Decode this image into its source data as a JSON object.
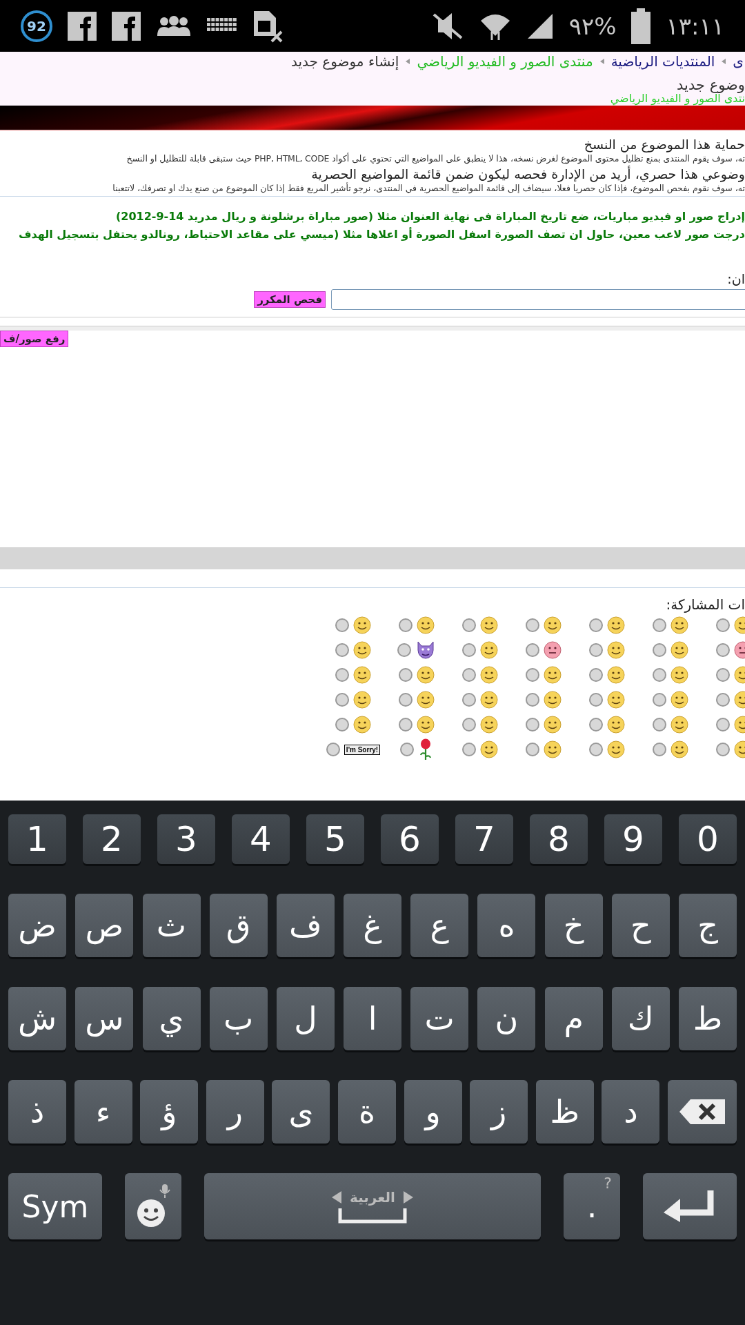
{
  "status_bar": {
    "badge": "92",
    "battery": "٩٢%",
    "time": "١٣:١١"
  },
  "breadcrumb": [
    {
      "text": "ى",
      "kind": "link"
    },
    {
      "text": "المنتديات الرياضية",
      "kind": "link"
    },
    {
      "text": "منتدى الصور و الفيديو الرياضي",
      "kind": "forum"
    },
    {
      "text": "إنشاء موضوع جديد",
      "kind": "current"
    }
  ],
  "page_title": "وضوع جديد",
  "forum_name": "نتدى الصور و الفيديو الرياضي",
  "options": [
    {
      "title": "حماية هذا الموضوع من النسخ",
      "description": "ته، سوف يقوم المنتدى بمنع تظليل محتوى الموضوع لغرض نسخه، هذا لا ينطبق على المواضيع التي تحتوي على أكواد PHP, HTML, CODE حيث ستبقى قابلة للتظليل او النسخ"
    },
    {
      "title": "وضوعي هذا حصري، أريد من الإدارة فحصه ليكون ضمن قائمة المواضيع الحصرية",
      "description": "ته، سوف نقوم بفحص الموضوع، فإذا كان حصريا فعلا، سيضاف إلى قائمة المواضيع الحصرية في المنتدى، نرجو تأشير المربع فقط إذا كان الموضوع من صنع يدك او تصرفك، لاتتعبنا"
    }
  ],
  "notice": [
    "إدراج صور او فيديو مباريات، ضع تاريخ المباراة فى نهاية العنوان مثلا (صور مباراة برشلونة و ريال مدريد 14-9-2012)",
    "درجت صور لاعب معين، حاول ان تصف الصورة اسفل الصورة أو اعلاها مثلا (ميسي على مقاعد الاحتياط، رونالدو يحتفل بتسجيل الهدف"
  ],
  "title_field": {
    "label": "ان:",
    "check_button": "فحص المكرر"
  },
  "upload_button": "رفع صور/ف",
  "smilies": {
    "label": "ات المشاركة:",
    "rows": [
      [
        {
          "kind": "smile",
          "selected": false
        },
        {
          "kind": "smile",
          "selected": false
        },
        {
          "kind": "smile",
          "selected": false
        },
        {
          "kind": "smile",
          "selected": false
        },
        {
          "kind": "smile",
          "selected": false
        },
        {
          "kind": "smile",
          "selected": false
        },
        {
          "kind": "smile",
          "selected": false
        }
      ],
      [
        {
          "kind": "pink",
          "selected": false
        },
        {
          "kind": "smile",
          "selected": false
        },
        {
          "kind": "smile",
          "selected": false
        },
        {
          "kind": "pink",
          "selected": false
        },
        {
          "kind": "smile",
          "selected": false
        },
        {
          "kind": "devil",
          "selected": false
        },
        {
          "kind": "smile",
          "selected": false
        }
      ],
      [
        {
          "kind": "smile",
          "selected": false
        },
        {
          "kind": "smile",
          "selected": false
        },
        {
          "kind": "smile",
          "selected": false
        },
        {
          "kind": "smile",
          "selected": false
        },
        {
          "kind": "smile",
          "selected": false
        },
        {
          "kind": "smile",
          "selected": false
        },
        {
          "kind": "smile",
          "selected": false
        }
      ],
      [
        {
          "kind": "smile",
          "selected": false
        },
        {
          "kind": "smile",
          "selected": false
        },
        {
          "kind": "smile",
          "selected": false
        },
        {
          "kind": "smile",
          "selected": false
        },
        {
          "kind": "smile",
          "selected": false
        },
        {
          "kind": "smile",
          "selected": false
        },
        {
          "kind": "smile",
          "selected": false
        }
      ],
      [
        {
          "kind": "smile",
          "selected": false
        },
        {
          "kind": "smile",
          "selected": false
        },
        {
          "kind": "smile",
          "selected": false
        },
        {
          "kind": "smile",
          "selected": false
        },
        {
          "kind": "smile",
          "selected": false
        },
        {
          "kind": "smile",
          "selected": false
        },
        {
          "kind": "smile",
          "selected": false
        }
      ],
      [
        {
          "kind": "smile",
          "selected": false
        },
        {
          "kind": "smile",
          "selected": false
        },
        {
          "kind": "smile",
          "selected": false
        },
        {
          "kind": "smile",
          "selected": false
        },
        {
          "kind": "smile",
          "selected": false
        },
        {
          "kind": "rose",
          "selected": false
        },
        {
          "kind": "sign",
          "sign": "I'm Sorry!",
          "selected": false
        }
      ]
    ]
  },
  "keyboard": {
    "numbers": [
      "0",
      "9",
      "8",
      "7",
      "6",
      "5",
      "4",
      "3",
      "2",
      "1"
    ],
    "rows": [
      [
        "ج",
        "ح",
        "خ",
        "ه",
        "ع",
        "غ",
        "ف",
        "ق",
        "ث",
        "ص",
        "ض"
      ],
      [
        "ط",
        "ك",
        "م",
        "ن",
        "ت",
        "ا",
        "ل",
        "ب",
        "ي",
        "س",
        "ش"
      ]
    ],
    "shift_row": [
      "د",
      "ظ",
      "ز",
      "و",
      "ة",
      "ى",
      "ر",
      "ؤ",
      "ء",
      "ذ"
    ],
    "sym": "Sym",
    "language": "العربية",
    "period": ".",
    "period_hint": "?"
  }
}
